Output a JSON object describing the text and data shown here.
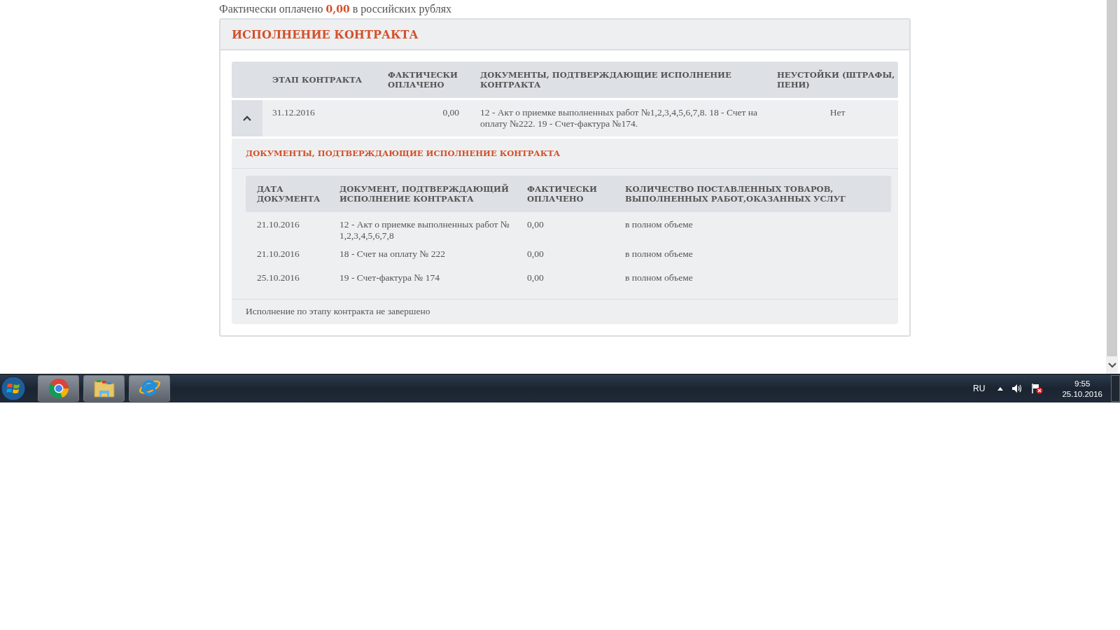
{
  "summary": {
    "label": "Фактически оплачено",
    "amount": "0,00",
    "suffix": "в российских рублях"
  },
  "panel": {
    "title": "ИСПОЛНЕНИЕ КОНТРАКТА",
    "table": {
      "columns": [
        "ЭТАП КОНТРАКТА",
        "ФАКТИЧЕСКИ ОПЛАЧЕНО",
        "ДОКУМЕНТЫ, ПОДТВЕРЖДАЮЩИЕ ИСПОЛНЕНИЕ КОНТРАКТА",
        "НЕУСТОЙКИ (ШТРАФЫ, ПЕНИ)"
      ],
      "rows": [
        {
          "expanded": true,
          "stage": "31.12.2016",
          "paid": "0,00",
          "documents": "12 - Акт о приемке выполненных работ №1,2,3,4,5,6,7,8. 18 - Счет на оплату №222. 19 - Счет-фактура №174.",
          "penalties": "Нет",
          "details": {
            "title": "ДОКУМЕНТЫ, ПОДТВЕРЖДАЮЩИЕ ИСПОЛНЕНИЕ КОНТРАКТА",
            "columns": [
              "ДАТА ДОКУМЕНТА",
              "ДОКУМЕНТ, ПОДТВЕРЖДАЮЩИЙ ИСПОЛНЕНИЕ КОНТРАКТА",
              "ФАКТИЧЕСКИ ОПЛАЧЕНО",
              "КОЛИЧЕСТВО ПОСТАВЛЕННЫХ ТОВАРОВ, ВЫПОЛНЕННЫХ РАБОТ,ОКАЗАННЫХ УСЛУГ"
            ],
            "rows": [
              [
                "21.10.2016",
                "12 - Акт о приемке выполненных работ № 1,2,3,4,5,6,7,8",
                "0,00",
                "в полном объеме"
              ],
              [
                "21.10.2016",
                "18 - Счет на оплату № 222",
                "0,00",
                "в полном объеме"
              ],
              [
                "25.10.2016",
                "19 - Счет-фактура № 174",
                "0,00",
                "в полном объеме"
              ]
            ],
            "status": "Исполнение по этапу контракта не завершено"
          }
        }
      ]
    }
  },
  "taskbar": {
    "apps": [
      {
        "kind": "chrome"
      },
      {
        "kind": "folder"
      },
      {
        "kind": "ie"
      }
    ],
    "tray": {
      "language": "RU",
      "time": "9:55",
      "date": "25.10.2016"
    }
  }
}
